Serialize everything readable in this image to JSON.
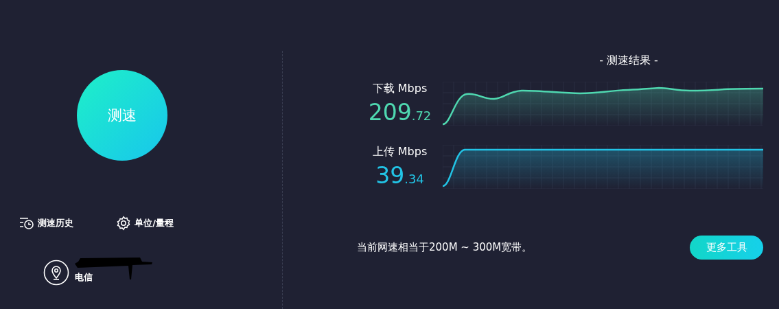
{
  "speed_button": {
    "label": "测速"
  },
  "links": [
    {
      "kind": "history",
      "label": "测速历史"
    },
    {
      "kind": "settings",
      "label": "单位/量程"
    }
  ],
  "location": {
    "isp": "电信"
  },
  "results": {
    "title": "- 测速结果 -",
    "rows": [
      {
        "kind": "download",
        "label": "下载 Mbps",
        "integer": "209",
        "decimal": ".72",
        "color": "#4fd8b0"
      },
      {
        "kind": "upload",
        "label": "上传 Mbps",
        "integer": "39",
        "decimal": ".34",
        "color": "#22c4e6"
      }
    ]
  },
  "summary": "当前网速相当于200M ~ 300M宽带。",
  "more_button": {
    "label": "更多工具"
  }
}
